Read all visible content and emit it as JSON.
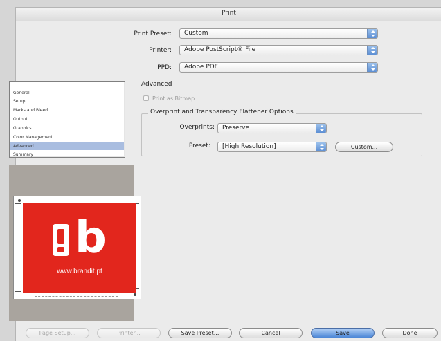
{
  "window": {
    "title": "Print"
  },
  "preset_rows": [
    {
      "label": "Print Preset:",
      "value": "Custom"
    },
    {
      "label": "Printer:",
      "value": "Adobe PostScript® File"
    },
    {
      "label": "PPD:",
      "value": "Adobe PDF"
    }
  ],
  "sidebar": {
    "items": [
      {
        "label": "General",
        "selected": false
      },
      {
        "label": "Setup",
        "selected": false
      },
      {
        "label": "Marks and Bleed",
        "selected": false
      },
      {
        "label": "Output",
        "selected": false
      },
      {
        "label": "Graphics",
        "selected": false
      },
      {
        "label": "Color Management",
        "selected": false
      },
      {
        "label": "Advanced",
        "selected": true
      },
      {
        "label": "Summary",
        "selected": false
      }
    ]
  },
  "advanced": {
    "heading": "Advanced",
    "print_as_bitmap": {
      "label": "Print as Bitmap",
      "checked": false,
      "enabled": false
    },
    "group_title": "Overprint and Transparency Flattener Options",
    "overprints": {
      "label": "Overprints:",
      "value": "Preserve"
    },
    "preset": {
      "label": "Preset:",
      "value": "[High Resolution]"
    },
    "custom_button": "Custom..."
  },
  "preview": {
    "brand_mark": "!b",
    "brand_url": "www.brandit.pt",
    "brand_color": "#e2261d"
  },
  "buttons": {
    "page_setup": "Page Setup...",
    "printer": "Printer...",
    "save_preset": "Save Preset...",
    "cancel": "Cancel",
    "save": "Save",
    "done": "Done"
  }
}
